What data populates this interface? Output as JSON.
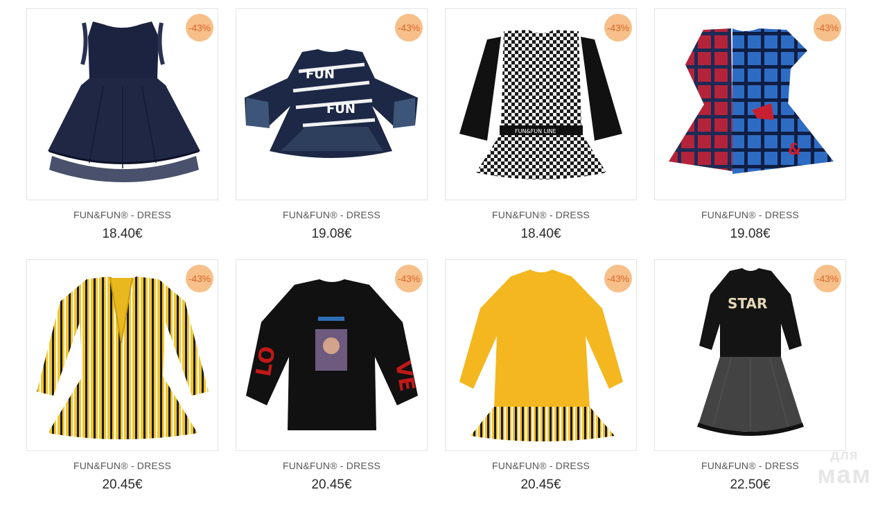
{
  "products": [
    {
      "name": "FUN&FUN® - DRESS",
      "price": "18.40€",
      "discount": "-43%",
      "image": "navy-pleated-dress"
    },
    {
      "name": "FUN&FUN® - DRESS",
      "price": "19.08€",
      "discount": "-43%",
      "image": "navy-letter-print-dress"
    },
    {
      "name": "FUN&FUN® - DRESS",
      "price": "18.40€",
      "discount": "-43%",
      "image": "houndstooth-dress"
    },
    {
      "name": "FUN&FUN® - DRESS",
      "price": "19.08€",
      "discount": "-43%",
      "image": "red-blue-plaid-dress"
    },
    {
      "name": "FUN&FUN® - DRESS",
      "price": "20.45€",
      "discount": "-43%",
      "image": "yellow-striped-dress"
    },
    {
      "name": "FUN&FUN® - DRESS",
      "price": "20.45€",
      "discount": "-43%",
      "image": "black-sweatshirt-dress"
    },
    {
      "name": "FUN&FUN® - DRESS",
      "price": "20.45€",
      "discount": "-43%",
      "image": "yellow-sweater-dress"
    },
    {
      "name": "FUN&FUN® - DRESS",
      "price": "22.50€",
      "discount": "-43%",
      "image": "black-star-tulle-dress"
    }
  ],
  "watermark": {
    "line1": "для",
    "line2": "мам"
  },
  "colors": {
    "badge_bg": "#f7c08a",
    "badge_text": "#d9662a",
    "border": "#e4e4e4"
  }
}
